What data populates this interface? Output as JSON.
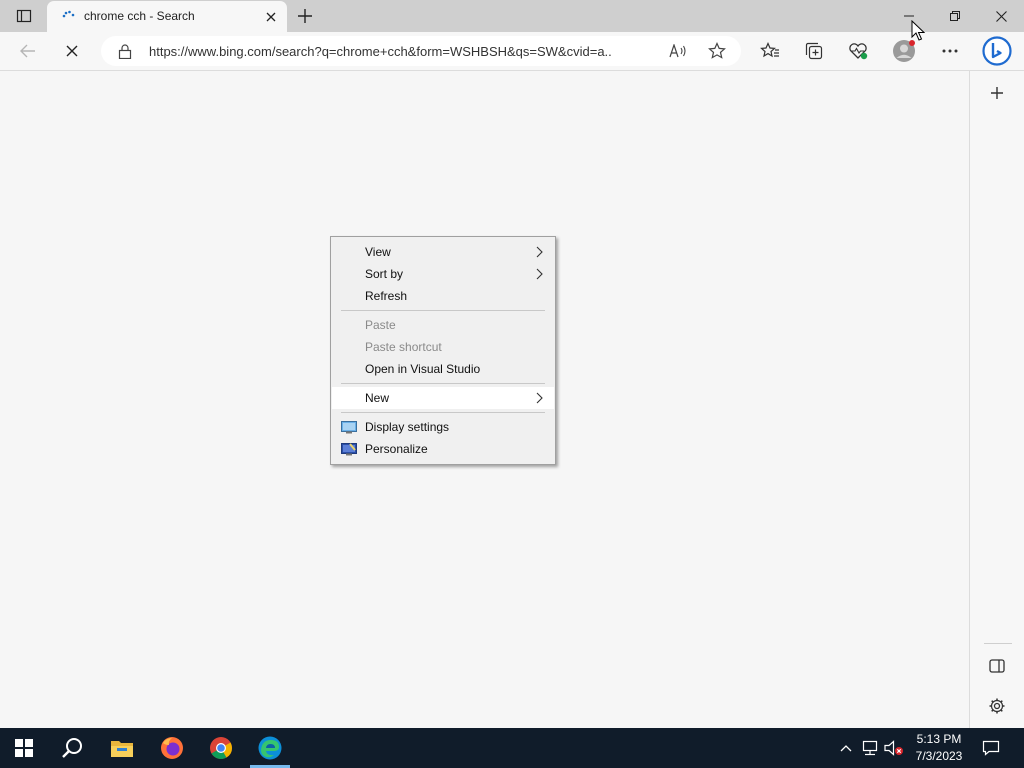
{
  "browser": {
    "tab": {
      "title": "chrome cch - Search"
    },
    "address_bar": {
      "url": "https://www.bing.com/search?q=chrome+cch&form=WSHBSH&qs=SW&cvid=a..."
    }
  },
  "context_menu": {
    "items": [
      {
        "label": "View",
        "submenu": true,
        "enabled": true
      },
      {
        "label": "Sort by",
        "submenu": true,
        "enabled": true
      },
      {
        "label": "Refresh",
        "submenu": false,
        "enabled": true
      },
      {
        "label": "Paste",
        "submenu": false,
        "enabled": false
      },
      {
        "label": "Paste shortcut",
        "submenu": false,
        "enabled": false
      },
      {
        "label": "Open in Visual Studio",
        "submenu": false,
        "enabled": true
      },
      {
        "label": "New",
        "submenu": true,
        "enabled": true,
        "highlighted": true
      },
      {
        "label": "Display settings",
        "icon": "display-icon",
        "enabled": true
      },
      {
        "label": "Personalize",
        "icon": "personalize-icon",
        "enabled": true
      }
    ]
  },
  "taskbar": {
    "apps": [
      "start-icon",
      "search-icon",
      "file-explorer-icon",
      "firefox-icon",
      "chrome-icon",
      "edge-icon"
    ],
    "clock": {
      "time": "5:13 PM",
      "date": "7/3/2023"
    }
  },
  "colors": {
    "taskbar_bg": "#101c2a",
    "tabbar_bg": "#cfcfcf",
    "menu_bg": "#f0f0f0",
    "accent_blue": "#0c6fcb"
  }
}
